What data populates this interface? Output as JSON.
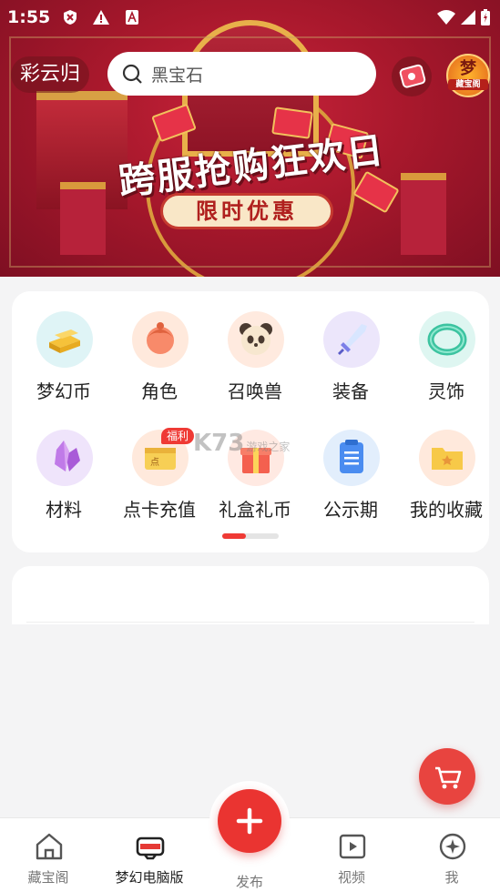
{
  "status_bar": {
    "time": "1:55"
  },
  "top_bar": {
    "city": "彩云归",
    "search_placeholder": "黑宝石",
    "logo_text": "梦",
    "logo_sub": "藏宝阁"
  },
  "banner": {
    "title": "跨服抢购狂欢日",
    "subtitle": "限时优惠"
  },
  "categories": [
    {
      "label": "梦幻币",
      "icon": "gold-bars-icon",
      "color": "#dff4f6"
    },
    {
      "label": "角色",
      "icon": "character-icon",
      "color": "#ffe9dc"
    },
    {
      "label": "召唤兽",
      "icon": "panda-icon",
      "color": "#ffeadf"
    },
    {
      "label": "装备",
      "icon": "sword-icon",
      "color": "#ece6fb"
    },
    {
      "label": "灵饰",
      "icon": "jade-bracelet-icon",
      "color": "#def6f1"
    },
    {
      "label": "材料",
      "icon": "crystal-icon",
      "color": "#efe4fb"
    },
    {
      "label": "点卡充值",
      "icon": "point-card-icon",
      "color": "#ffe9dc",
      "badge": "福利"
    },
    {
      "label": "礼盒礼币",
      "icon": "gift-box-icon",
      "color": "#ffe9e2"
    },
    {
      "label": "公示期",
      "icon": "clipboard-icon",
      "color": "#e2eefc"
    },
    {
      "label": "我的收藏",
      "icon": "star-folder-icon",
      "color": "#ffe9dc"
    }
  ],
  "pager": {
    "pages": 2,
    "current": 1
  },
  "watermark": {
    "text": "K73",
    "sub": "游戏之家"
  },
  "tabs": [
    {
      "label": "藏宝阁",
      "icon": "home-icon",
      "active": false
    },
    {
      "label": "梦幻电脑版",
      "icon": "gamepad-icon",
      "active": true
    },
    {
      "label": "发布",
      "icon": "plus-icon",
      "active": false
    },
    {
      "label": "视频",
      "icon": "video-icon",
      "active": false
    },
    {
      "label": "我",
      "icon": "compass-profile-icon",
      "active": false
    }
  ],
  "colors": {
    "accent": "#ea3431",
    "banner": "#a8182c"
  }
}
